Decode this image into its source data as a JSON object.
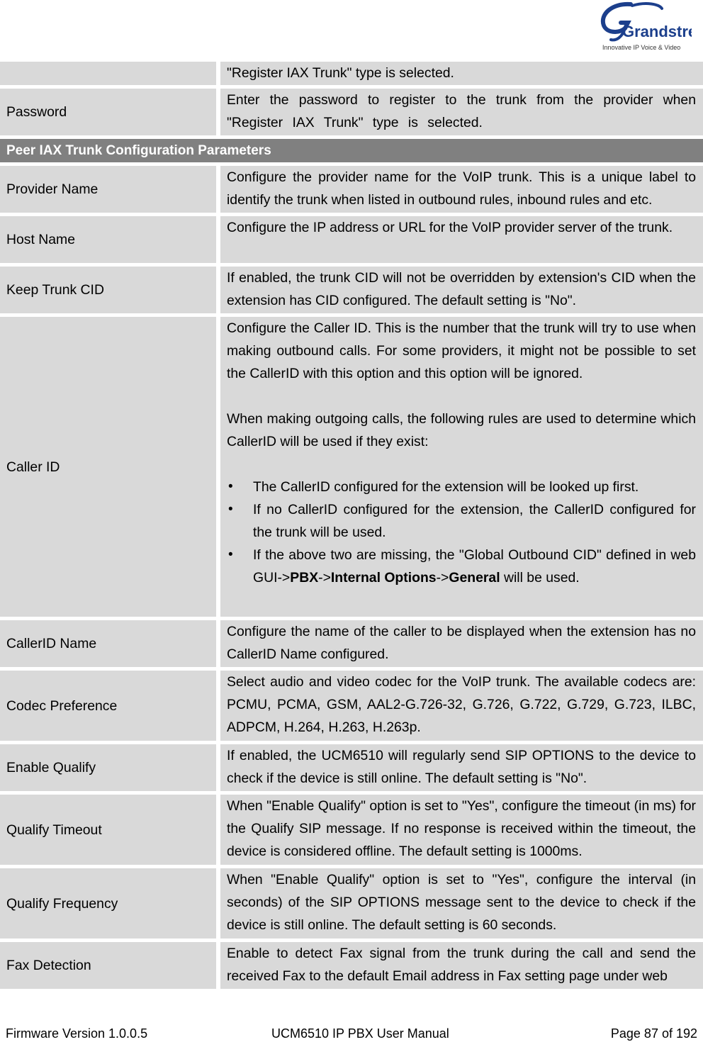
{
  "header": {
    "logo": {
      "brand": "Grandstream",
      "tagline": "Innovative IP Voice & Video",
      "brand_color": "#1c3f8c"
    }
  },
  "table": {
    "continuation_row": {
      "label": "",
      "description": "\"Register IAX Trunk\" type is selected."
    },
    "password_row": {
      "label": "Password",
      "description": "Enter the password to register to the trunk from the provider when \"Register IAX Trunk\" type is selected."
    },
    "section_header": "Peer IAX Trunk Configuration Parameters",
    "rows": [
      {
        "label": "Provider Name",
        "description": "Configure the provider name for the VoIP trunk. This is a unique label to identify the trunk when listed in outbound rules, inbound rules and etc."
      },
      {
        "label": "Host Name",
        "description": "Configure the IP address or URL for the VoIP provider server of the trunk."
      },
      {
        "label": "Keep Trunk CID",
        "description": "If enabled, the trunk CID will not be overridden by extension's CID when the extension has CID configured. The default setting is \"No\"."
      }
    ],
    "caller_id": {
      "label": "Caller ID",
      "para1": "Configure the Caller ID. This is the number that the trunk will try to use when making outbound calls. For some providers, it might not be possible to set the CallerID with this option and this option will be ignored.",
      "para2": "When making outgoing calls, the following rules are used to determine which CallerID will be used if they exist:",
      "bullets": [
        "The CallerID configured for the extension will be looked up first.",
        "If no CallerID configured for the extension, the CallerID configured for the trunk will be used."
      ],
      "bullet3": {
        "prefix": "If the above two are missing, the \"Global Outbound CID\" defined in web GUI->",
        "bold1": "PBX",
        "sep1": "->",
        "bold2": "Internal Options",
        "sep2": "->",
        "bold3": "General",
        "suffix": " will be used."
      },
      "bullet_glyph": "•"
    },
    "rows2": [
      {
        "label": "CallerID Name",
        "description": "Configure the name of the caller to be displayed when the extension has no CallerID Name configured."
      },
      {
        "label": "Codec Preference",
        "description": "Select audio and video codec for the VoIP trunk. The available codecs are: PCMU, PCMA, GSM, AAL2-G.726-32, G.726, G.722, G.729, G.723, ILBC, ADPCM, H.264, H.263, H.263p."
      },
      {
        "label": "Enable Qualify",
        "description": "If enabled, the UCM6510 will regularly send SIP OPTIONS to the device to check if the device is still online. The default setting is \"No\"."
      },
      {
        "label": "Qualify Timeout",
        "description": "When \"Enable Qualify\" option is set to \"Yes\", configure the timeout (in ms) for the Qualify SIP message. If no response is received within the timeout, the device is considered offline. The default setting is 1000ms."
      },
      {
        "label": "Qualify Frequency",
        "description": "When \"Enable Qualify\" option is set to \"Yes\", configure the interval (in seconds) of the SIP OPTIONS message sent to the device to check if the device is still online. The default setting is 60 seconds."
      },
      {
        "label": "Fax Detection",
        "description": "Enable to detect Fax signal from the trunk during the call and send the received Fax to the default Email address in Fax setting page under web"
      }
    ]
  },
  "footer": {
    "firmware": "Firmware Version 1.0.0.5",
    "manual_title": "UCM6510 IP PBX User Manual",
    "page": "Page 87 of 192"
  }
}
